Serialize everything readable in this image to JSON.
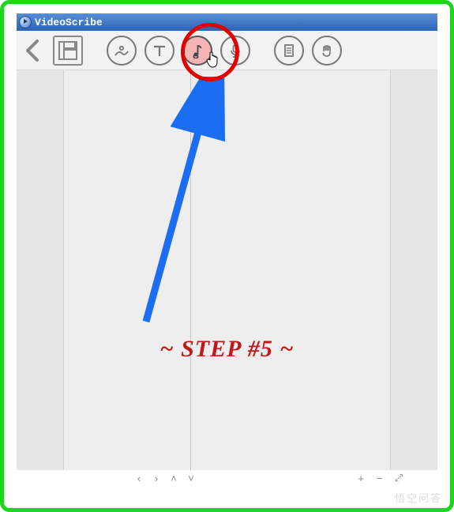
{
  "window": {
    "title": "VideoScribe"
  },
  "toolbar": {
    "back": "Back",
    "save": "Save",
    "image": "Add image",
    "text": "Add text",
    "music": "Add music",
    "voice": "Record voiceover",
    "paper": "Paper / canvas options",
    "hand": "Hand style"
  },
  "nav": {
    "prev": "‹",
    "next": "›",
    "up": "˄",
    "down": "˅",
    "zoom_in": "+",
    "zoom_out": "−",
    "fullscreen": "⤢"
  },
  "annotation": {
    "step_label": "~ STEP #5 ~"
  },
  "watermark": "悟空问答"
}
